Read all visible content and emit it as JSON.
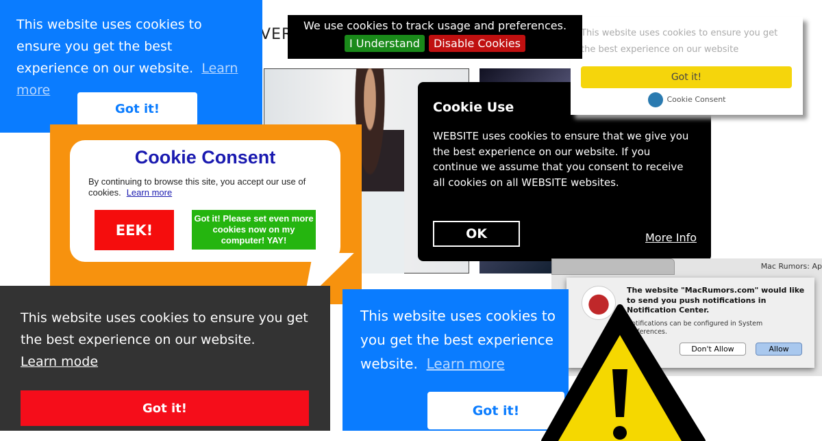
{
  "background": {
    "ver_text": "VER"
  },
  "black_bar": {
    "text": "We use cookies to track usage and preferences.",
    "understand": "I Understand",
    "disable": "Disable Cookies"
  },
  "top_right": {
    "text": "This website uses cookies to ensure you get the best experience on our website",
    "button": "Got it!",
    "brand": "Cookie Consent",
    "button_color": "#f5d50c"
  },
  "cookie_use": {
    "title": "Cookie Use",
    "body": "WEBSITE uses cookies to ensure that we give you the best experience on our website. If you continue we assume that you consent to receive all cookies on all WEBSITE websites.",
    "ok": "OK",
    "more": "More Info"
  },
  "blue_top": {
    "text": "This website uses cookies to ensure you get the best experience on our website.",
    "link": "Learn more",
    "button": "Got it!",
    "color": "#0a7cff"
  },
  "bubble": {
    "title": "Cookie Consent",
    "text": "By continuing to browse this site, you accept our use of cookies.",
    "link": "Learn more",
    "eek": "EEK!",
    "yay": "Got it!  Please set even more cookies now on my computer! YAY!"
  },
  "mac": {
    "window_title": "Mac Rumors: Ap",
    "heading": "The website \"MacRumors.com\" would like to send you push notifications in Notification Center.",
    "sub": "Notifications can be configured in System Preferences.",
    "deny": "Don't Allow",
    "allow": "Allow"
  },
  "blue_bottom": {
    "text1": "This website uses cookies to",
    "text2": "you get the best experience",
    "text3": "website.",
    "link": "Learn more",
    "button": "Got it!"
  },
  "dark": {
    "text": "This website uses cookies to ensure you get the best experience on our website.",
    "link": "Learn mode",
    "button": "Got it!"
  },
  "icons": {
    "warning": "warning-triangle-icon",
    "apple": "macrumors-apple-icon"
  }
}
